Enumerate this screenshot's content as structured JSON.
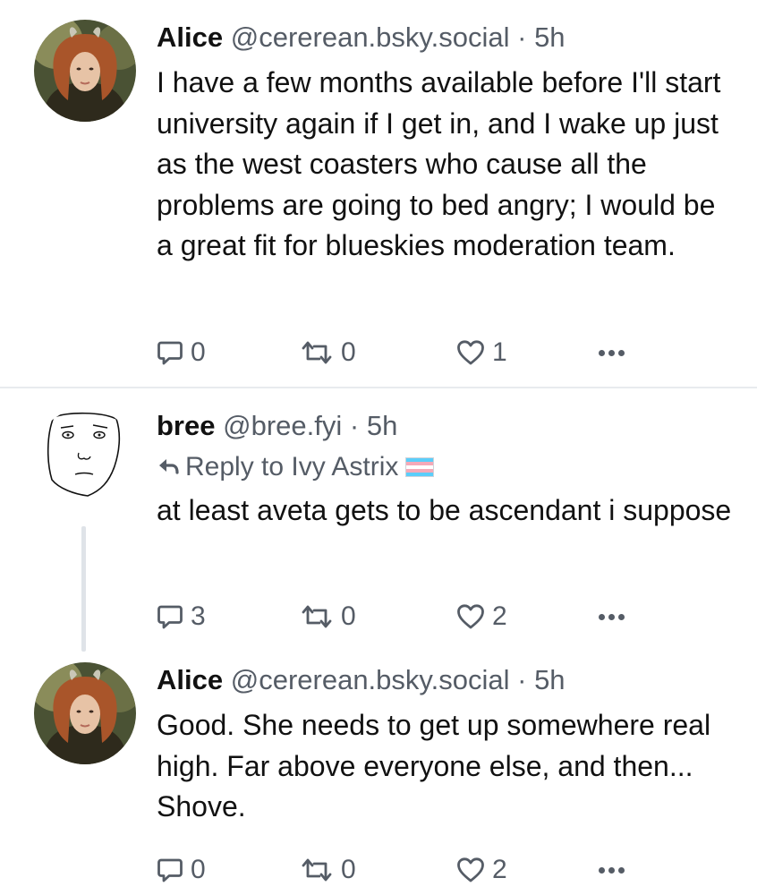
{
  "posts": [
    {
      "author": "Alice",
      "handle": "@cererean.bsky.social",
      "sep": "·",
      "time": "5h",
      "text": "I have a few months available before I'll start university again if I get in, and I wake up just as the west coasters who cause all the problems are going to bed angry; I would be a great fit for blueskies moderation team.",
      "replies": "0",
      "reposts": "0",
      "likes": "1",
      "avatar": "avatar-photo-alice"
    },
    {
      "author": "bree",
      "handle": "@bree.fyi",
      "sep": "·",
      "time": "5h",
      "reply_to": "Reply to Ivy Astrix",
      "reply_flag": "trans-flag-emoji",
      "text": "at least aveta gets to be ascendant i suppose",
      "replies": "3",
      "reposts": "0",
      "likes": "2",
      "avatar": "avatar-face-sketch"
    },
    {
      "author": "Alice",
      "handle": "@cererean.bsky.social",
      "sep": "·",
      "time": "5h",
      "text": "Good. She needs to get up somewhere real high. Far above everyone else, and then... Shove.",
      "replies": "0",
      "reposts": "0",
      "likes": "2",
      "avatar": "avatar-photo-alice"
    }
  ],
  "icons": {
    "reply": "speech-bubble-icon",
    "repost": "repost-arrows-icon",
    "like": "heart-icon",
    "more": "more-dots-icon",
    "reply_arrow": "reply-arrow-icon"
  },
  "colors": {
    "text": "#111111",
    "muted": "#555c66",
    "divider": "#e8ebee",
    "thread_line": "#dfe3e8",
    "trans_blue": "#5bcefa",
    "trans_pink": "#f5a9b8"
  }
}
